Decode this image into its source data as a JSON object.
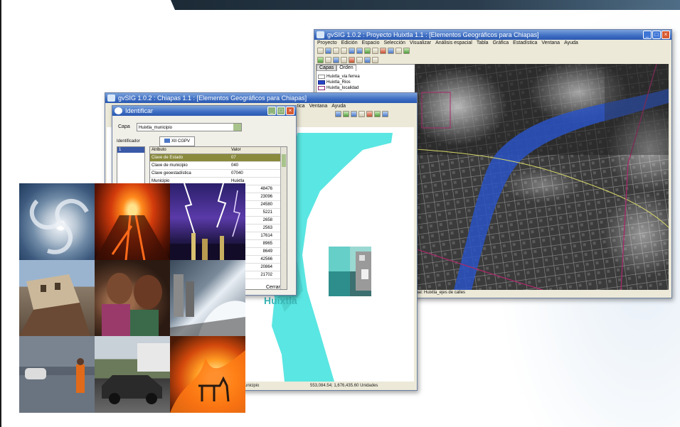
{
  "gis_window_1": {
    "title": "gvSIG 1.0.2 : Proyecto Huixtla 1.1 : [Elementos Geográficos para Chiapas]",
    "menu": [
      "Proyecto",
      "Edición",
      "Espacio",
      "Selección",
      "Visualizar",
      "Análisis espacial",
      "Tabla",
      "Gráfica",
      "Estadística",
      "Ventana",
      "Ayuda"
    ],
    "toc_tabs": [
      "Capas",
      "Orden"
    ],
    "layers": [
      "Huixtla_via ferrea",
      "Huixtla_Rios",
      "Huixtla_localidad"
    ],
    "status": "tual: Huixtla_ejes de calles"
  },
  "gis_window_2": {
    "title": "gvSIG 1.0.2 : Chiapas 1.1 : [Elementos Geográficos para Chiapas]",
    "menu_fragment": [
      "tica",
      "Ventana",
      "Ayuda"
    ],
    "map_label": "Huixtla",
    "status_left": "unicipio",
    "status_coords": "553,084.54; 1,676,435.60 Unidades"
  },
  "identify_dialog": {
    "title": "Identificar",
    "layer_label": "Capa",
    "layer_value": "Huixtla_municipio",
    "id_label": "Identificador",
    "id_selected": "1",
    "tab_label": "XII CGPV 2000",
    "col_attr": "Atributo",
    "col_value": "Valor",
    "rows": [
      {
        "attr": "Clave de Estado",
        "value": "07"
      },
      {
        "attr": "Clave de municipio",
        "value": "040"
      },
      {
        "attr": "Clave geoestadística",
        "value": "07040"
      },
      {
        "attr": "Municipio",
        "value": "Huixtla"
      },
      {
        "attr": "",
        "value": "48476"
      },
      {
        "attr": "",
        "value": "23096"
      },
      {
        "attr": "",
        "value": "24580"
      },
      {
        "attr": "",
        "value": "5221"
      },
      {
        "attr": "",
        "value": "2658"
      },
      {
        "attr": "",
        "value": "2563"
      },
      {
        "attr": "",
        "value": "17614"
      },
      {
        "attr": "",
        "value": "8965"
      },
      {
        "attr": "",
        "value": "8649"
      },
      {
        "attr": "",
        "value": "42566"
      },
      {
        "attr": "",
        "value": "20864"
      },
      {
        "attr": "",
        "value": "21702"
      }
    ],
    "close_label": "Cerrar"
  },
  "collage": {
    "tiles": [
      "hurricane-photo",
      "volcano-photo",
      "lightning-photo",
      "collapsed-building-photo",
      "disaster-victims-photo",
      "storm-surge-photo",
      "flood-photo",
      "damaged-cars-photo",
      "wildfire-photo"
    ]
  }
}
